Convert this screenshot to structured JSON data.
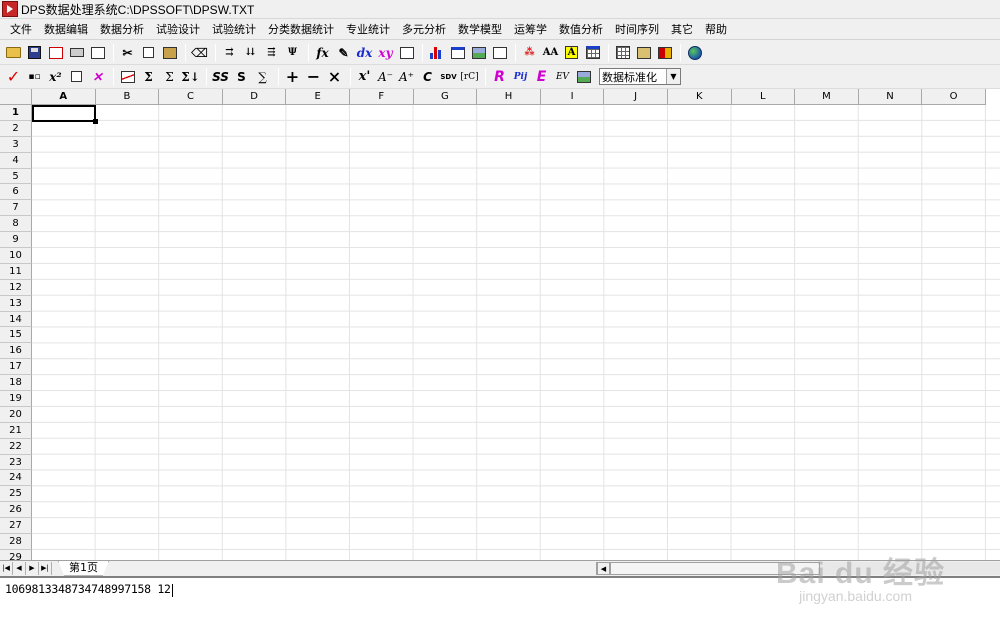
{
  "window": {
    "title": "DPS数据处理系统C:\\DPSSOFT\\DPSW.TXT"
  },
  "menu": [
    "文件",
    "数据编辑",
    "数据分析",
    "试验设计",
    "试验统计",
    "分类数据统计",
    "专业统计",
    "多元分析",
    "数学模型",
    "运筹学",
    "数值分析",
    "时间序列",
    "其它",
    "帮助"
  ],
  "toolbar2": {
    "labels": {
      "x2": "x²",
      "sigma1": "Σ",
      "sigma2": "Σ↓",
      "ss": "SS",
      "s": "S",
      "sum": "∑",
      "plus": "+",
      "minus": "−",
      "times": "×",
      "xpow": "x'",
      "a_minus": "A⁻",
      "a_plus": "A⁺",
      "c": "C",
      "sdv": "SDV",
      "trc": "[rC]",
      "r": "R",
      "pij": "Pij",
      "e": "E",
      "ev": "EV"
    },
    "combo_value": "数据标准化"
  },
  "toolbar1": {
    "labels": {
      "fx": "fx",
      "dx": "dx",
      "xy": "xy",
      "aa": "AA",
      "a_box": "A"
    }
  },
  "sheet": {
    "columns": [
      "A",
      "B",
      "C",
      "D",
      "E",
      "F",
      "G",
      "H",
      "I",
      "J",
      "K",
      "L",
      "M",
      "N",
      "O"
    ],
    "rows": [
      "1",
      "2",
      "3",
      "4",
      "5",
      "6",
      "7",
      "8",
      "9",
      "10",
      "11",
      "12",
      "13",
      "14",
      "15",
      "16",
      "17",
      "18",
      "19",
      "20",
      "21",
      "22",
      "23",
      "24",
      "25",
      "26",
      "27",
      "28",
      "29"
    ],
    "active_cell": "A1"
  },
  "tabs": {
    "sheet1": "第1页"
  },
  "output": {
    "text": "1069813348734748997158 12"
  },
  "watermark": {
    "logo": "Bai du 经验",
    "site": "jingyan.baidu.com"
  }
}
